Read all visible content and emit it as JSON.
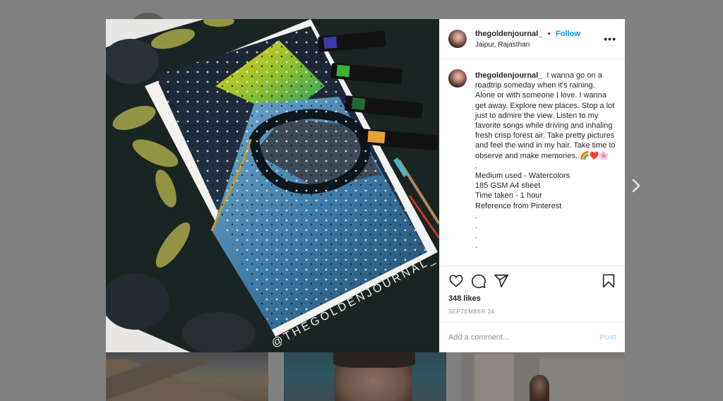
{
  "post": {
    "author": {
      "username": "thegoldenjournal_",
      "location": "Jaipur, Rajasthan",
      "avatar_icon": "profile-photo"
    },
    "follow_label": "Follow",
    "separator": "•",
    "more_icon": "ellipsis-icon",
    "image": {
      "description": "Watercolor painting of a rainy windshield view of a road and forest, with paint tubes, stones and leaves",
      "watermark": "@THEGOLDENJOURNAL_"
    },
    "caption": {
      "username": "thegoldenjournal_",
      "text": "I wanna go on a roadtrip someday when it's raining. Alone or with someone I love. I wanna get away. Explore new places. Stop a lot just to admire the view. Listen to my favorite songs while driving and inhaling fresh crisp forest air. Take pretty pictures and feel the wind in my hair. Take time to observe and make memories. 🌈❤️🌸",
      "lines": [
        ".",
        "Medium used - Watercolors",
        "185 GSM A4 sheet",
        "Time taken - 1 hour",
        "Reference from Pinterest",
        ".",
        ".",
        ".",
        "."
      ]
    },
    "actions": {
      "like_icon": "heart-icon",
      "comment_icon": "comment-icon",
      "share_icon": "paper-plane-icon",
      "save_icon": "bookmark-icon"
    },
    "likes": "348 likes",
    "date": "September 24",
    "comment_input": {
      "placeholder": "Add a comment...",
      "value": ""
    },
    "post_label": "Post"
  },
  "navigation": {
    "next_icon": "chevron-right-icon"
  },
  "colors": {
    "accent": "#0095f6",
    "post_disabled": "#b2dffc",
    "overlay": "#808080",
    "text": "#262626",
    "muted": "#8e8e8e"
  }
}
